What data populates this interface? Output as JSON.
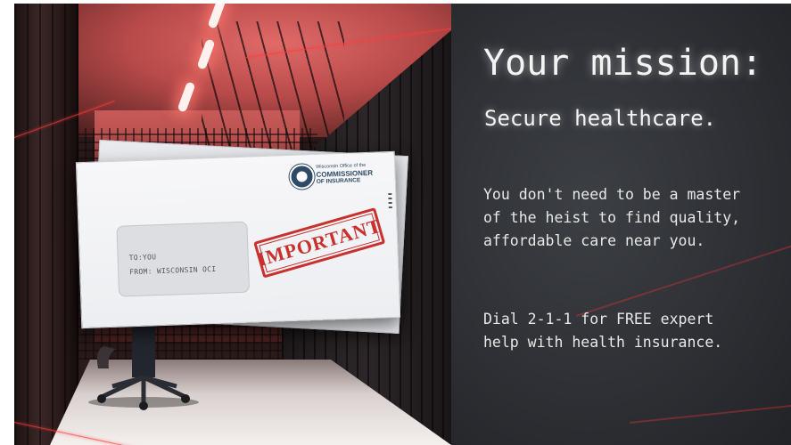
{
  "envelope": {
    "to_line": "TO:YOU",
    "from_line": "FROM: WISCONSIN OCI",
    "stamp_text": "IMPORTANT",
    "logo": {
      "line1": "Wisconsin Office of the",
      "line2": "COMMISSIONER",
      "line3": "OF INSURANCE"
    }
  },
  "panel": {
    "headline": "Your mission:",
    "subheadline": "Secure healthcare.",
    "paragraph1": [
      "You don't need to be a master",
      "of the heist to find quality,",
      "affordable care near you."
    ],
    "paragraph2": [
      "Dial 2-1-1 for FREE expert",
      "help with health insurance."
    ]
  },
  "colors": {
    "stamp_red": "#c8312e",
    "logo_blue": "#2e4a66",
    "panel_bg": "#2e3035",
    "text_white": "#f4f4f4",
    "room_red": "#c75a58"
  }
}
